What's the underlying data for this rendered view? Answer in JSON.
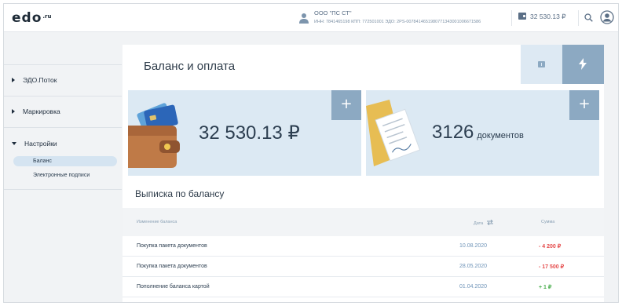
{
  "header": {
    "logo_main": "edo",
    "logo_sub": ".ru",
    "org_name": "ООО \"ПС СТ\"",
    "org_requisites": "ИНН: 7841465198   КПП: 772501001   ЭДО: 2PS-0078414651980771343001006671586",
    "balance": "32 530.13 ₽",
    "icons": [
      "user-icon",
      "wallet-icon",
      "search-icon",
      "account-icon"
    ]
  },
  "sidebar": {
    "items": [
      {
        "label": "ЭДО.Поток",
        "expanded": false
      },
      {
        "label": "Маркировка",
        "expanded": false
      },
      {
        "label": "Настройки",
        "expanded": true
      }
    ],
    "subitems": [
      {
        "label": "Баланс",
        "active": true
      },
      {
        "label": "Электронные подписи",
        "active": false
      }
    ]
  },
  "main": {
    "title": "Баланс и оплата",
    "tabs": [
      "wallet-icon",
      "bolt-icon"
    ],
    "balance_panel": {
      "amount": "32 530.13 ₽",
      "add_label": "+"
    },
    "docs_panel": {
      "count": "3126",
      "unit": "документов",
      "add_label": "+"
    },
    "statement": {
      "title": "Выписка по балансу",
      "columns": {
        "change": "Изменение баланса",
        "date": "Дата",
        "sum": "Сумма"
      },
      "rows": [
        {
          "desc": "Покупка пакета документов",
          "date": "10.08.2020",
          "sum": "- 4 200 ₽",
          "sign": "neg"
        },
        {
          "desc": "Покупка пакета документов",
          "date": "28.05.2020",
          "sum": "- 17 500 ₽",
          "sign": "neg"
        },
        {
          "desc": "Пополнение баланса картой",
          "date": "01.04.2020",
          "sum": "+ 1 ₽",
          "sign": "pos"
        }
      ]
    }
  },
  "colors": {
    "accent": "#8ca9c2",
    "panel_bg": "#dce9f3",
    "negative": "#e54b4b",
    "positive": "#4caf50"
  }
}
